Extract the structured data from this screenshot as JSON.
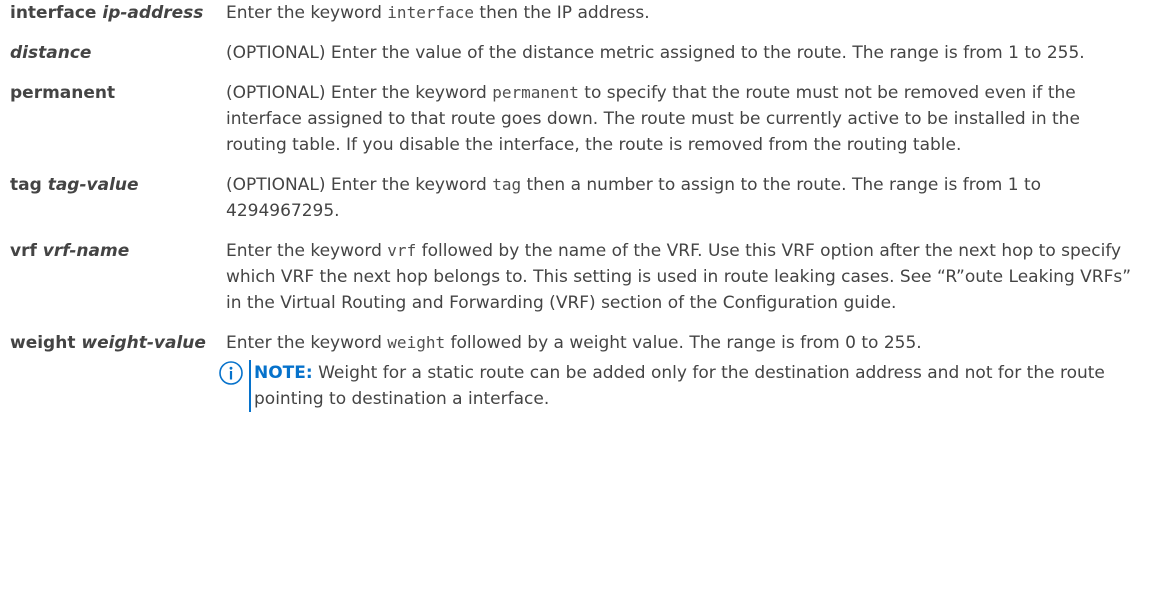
{
  "rows": [
    {
      "term_word": "interface",
      "term_arg": "ip-address",
      "desc_pre": "Enter the keyword ",
      "desc_code": "interface",
      "desc_post": " then the IP address."
    },
    {
      "term_word": "",
      "term_arg": "distance",
      "desc": "(OPTIONAL) Enter the value of the distance metric assigned to the route. The range is from 1 to 255."
    },
    {
      "term_word": "permanent",
      "term_arg": "",
      "desc_pre": "(OPTIONAL) Enter the keyword ",
      "desc_code": "permanent",
      "desc_post": " to specify that the route must not be removed even if the interface assigned to that route goes down. The route must be currently active to be installed in the routing table. If you disable the interface, the route is removed from the routing table."
    },
    {
      "term_word": "tag",
      "term_arg": "tag-value",
      "desc_pre": "(OPTIONAL) Enter the keyword ",
      "desc_code": "tag",
      "desc_post": " then a number to assign to the route. The range is from 1 to 4294967295."
    },
    {
      "term_word": "vrf",
      "term_arg": "vrf-name",
      "desc_pre": "Enter the keyword ",
      "desc_code": "vrf",
      "desc_post": " followed by the name of the VRF. Use this VRF option after the next hop to specify which VRF the next hop belongs to. This setting is used in route leaking cases. See “R”oute Leaking VRFs” in the Virtual Routing and Forwarding (VRF) section of the Configuration guide."
    },
    {
      "term_word": "weight",
      "term_arg": "weight-value",
      "desc_pre": "Enter the keyword ",
      "desc_code": "weight",
      "desc_post": " followed by a weight value. The range is from 0 to 255.",
      "note_label": "NOTE:",
      "note_text": " Weight for a static route can be added only for the destination address and not for the route pointing to destination a interface."
    }
  ],
  "icons": {
    "note": "info-icon"
  },
  "colors": {
    "text": "#444444",
    "note_accent": "#0672cb"
  }
}
